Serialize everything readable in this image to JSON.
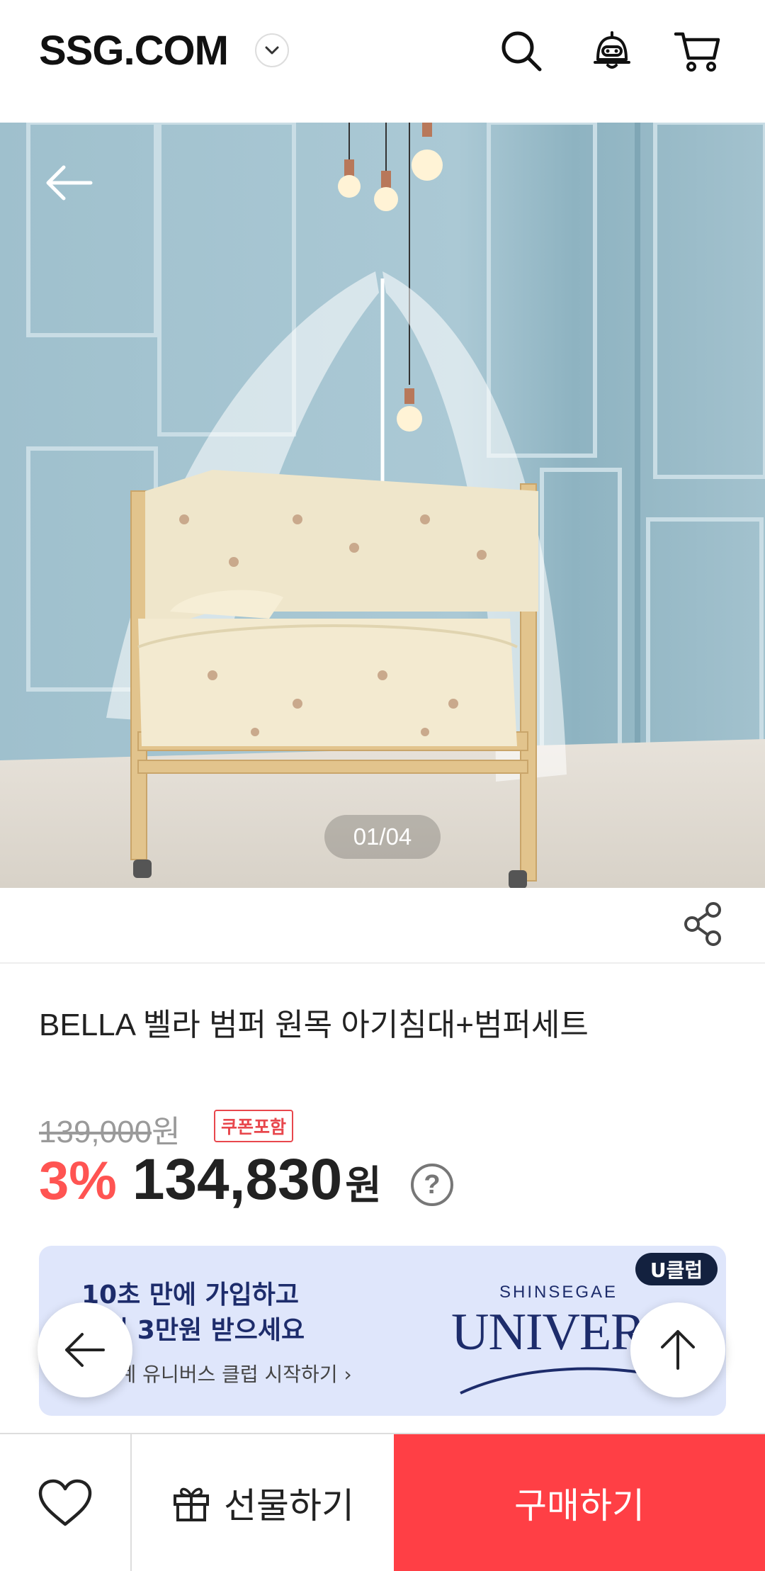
{
  "header": {
    "logo": "SSG.COM",
    "icons": [
      "chevron-down-icon",
      "search-icon",
      "chatbot-icon",
      "cart-icon"
    ]
  },
  "gallery": {
    "counter": "01/04"
  },
  "product": {
    "title": "BELLA 벨라 범퍼 원목 아기침대+범퍼세트",
    "original_price": "139,000",
    "original_unit": "원",
    "coupon_badge": "쿠폰포함",
    "discount": "3%",
    "price": "134,830",
    "price_unit": "원",
    "help": "?"
  },
  "banner": {
    "line1": "10초 만에 가입하고",
    "line2": "즉시 3만원 받으세요",
    "line3": "신세계 유니버스 클럽 시작하기 ›",
    "badge": "U클럽",
    "brand_top": "SHINSEGAE",
    "brand_main": "UNIVERSE"
  },
  "bottom_bar": {
    "gift_label": "선물하기",
    "buy_label": "구매하기"
  },
  "colors": {
    "accent_red": "#ff3f45",
    "discount_red": "#ff5452",
    "banner_bg": "#dfe6fb",
    "banner_text": "#1d2c6b"
  }
}
